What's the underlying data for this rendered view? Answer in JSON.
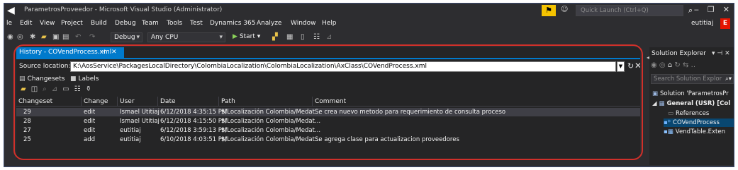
{
  "window": {
    "title": "ParametrosProveedor - Microsoft Visual Studio (Administrator)",
    "quick_launch_placeholder": "Quick Launch (Ctrl+Q)",
    "minimize": "‒",
    "restore": "❐",
    "close": "✕"
  },
  "menu": {
    "items": [
      "le",
      "Edit",
      "View",
      "Project",
      "Build",
      "Debug",
      "Team",
      "Tools",
      "Test",
      "Dynamics 365",
      "Analyze",
      "Window",
      "Help"
    ],
    "user_name": "eutitiaj",
    "user_initial": "E"
  },
  "toolbar": {
    "configuration": "Debug",
    "platform": "Any CPU",
    "start_label": "Start"
  },
  "history": {
    "tab_title": "History - COVendProcess.xml",
    "source_label": "Source location:",
    "source_path": "K:\\AosService\\PackagesLocalDirectory\\ColombiaLocalization\\ColombiaLocalization\\AxClass\\COVendProcess.xml",
    "subtabs": [
      "Changesets",
      "Labels"
    ],
    "columns": [
      "Changeset",
      "Change",
      "User",
      "Date",
      "Path",
      "Comment"
    ],
    "rows": [
      {
        "changeset": "29",
        "change": "edit",
        "user": "Ismael Utitiaj",
        "date": "6/12/2018 4:35:15 PM",
        "path": "$/Localización Colombia/Medat...",
        "comment": "Se crea nuevo metodo para requerimiento de consulta proceso"
      },
      {
        "changeset": "28",
        "change": "edit",
        "user": "Ismael Utitiaj",
        "date": "6/12/2018 4:15:50 PM",
        "path": "$/Localización Colombia/Medat...",
        "comment": ""
      },
      {
        "changeset": "27",
        "change": "edit",
        "user": "eutitiaj",
        "date": "6/12/2018 3:59:13 PM",
        "path": "$/Localización Colombia/Medat...",
        "comment": ""
      },
      {
        "changeset": "25",
        "change": "add",
        "user": "eutitiaj",
        "date": "6/10/2018 4:03:51 PM",
        "path": "$/Localización Colombia/Medat...",
        "comment": "Se agrega clase para actualizacion proveedores"
      }
    ]
  },
  "solution_explorer": {
    "title": "Solution Explorer",
    "search_placeholder": "Search Solution Explor",
    "tree": [
      {
        "label": "Solution 'ParametrosPr",
        "bold": false
      },
      {
        "label": "General (USR) [Col",
        "bold": true
      },
      {
        "label": "References",
        "bold": false
      },
      {
        "label": "COVendProcess",
        "bold": false
      },
      {
        "label": "VendTable.Exten",
        "bold": false
      }
    ]
  },
  "colors": {
    "accent": "#007acc",
    "highlight_ring": "#d0302a",
    "flag": "#f5c300",
    "avatar": "#e51400"
  }
}
